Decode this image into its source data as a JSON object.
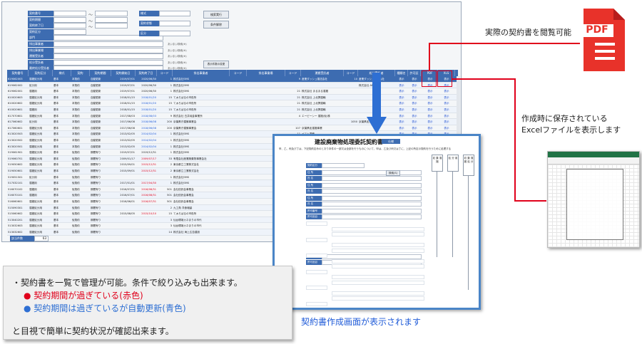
{
  "search": {
    "labels": [
      "契約番号",
      "契約期間",
      "契約終了日",
      "契約区分",
      "部門",
      "排出事業者",
      "排出事業場",
      "運搬受託者",
      "処分受託者",
      "最終処分受託者"
    ],
    "right_labels": [
      "様式",
      "契約状態",
      "区分"
    ],
    "search_button": "検索実行",
    "clear_button": "条件解除",
    "extra_button": "表示件数の変更",
    "hint": "あいまい検索(※)",
    "tilde": "〜"
  },
  "table": {
    "headers": [
      "契約番号",
      "契約区分",
      "様式",
      "契約",
      "契約期間",
      "契約開始日",
      "契約終了日",
      "コード",
      "排出事業者",
      "コード",
      "排出事業場",
      "コード",
      "運搬受託者",
      "コード",
      "処分受託者",
      "種類名",
      "許可証",
      "PDF",
      "XLS"
    ],
    "rows": [
      {
        "no": "619062003",
        "kubun": "運搬処分用",
        "style": "基本",
        "keiyaku": "本契約",
        "kikan": "自動更新",
        "start": "2019/07/01",
        "end": "2020/06/30",
        "code1": "1",
        "haishutsu": "株式会社SMS",
        "code3": "9",
        "unpan": "産業ダッシュ運送会社",
        "code4": "10",
        "shobun": "産業ダッシュ処分会社",
        "link1": "表示",
        "link2": "表示",
        "pdf": "表示",
        "xls": "表示",
        "state": "sel"
      },
      {
        "no": "619062002",
        "kubun": "処分用",
        "style": "基本",
        "keiyaku": "本契約",
        "kikan": "自動更新",
        "start": "2019/07/01",
        "end": "2020/06/30",
        "code1": "1",
        "haishutsu": "株式会社SMS",
        "code3": "",
        "unpan": "",
        "code4": "",
        "shobun": "株式会社 AR",
        "link1": "表示",
        "link2": "表示",
        "pdf": "表示",
        "xls": "表示",
        "state": "alt"
      },
      {
        "no": "619062001",
        "kubun": "運搬用",
        "style": "基本",
        "keiyaku": "本契約",
        "kikan": "自動更新",
        "start": "2019/07/01",
        "end": "2020/06/30",
        "code1": "1",
        "haishutsu": "株式会社SMS",
        "code3": "21",
        "unpan": "株式会社 まるまる運搬",
        "code4": "",
        "shobun": "",
        "link1": "表示",
        "link2": "表示",
        "pdf": "表示",
        "xls": "表示",
        "state": ""
      },
      {
        "no": "610020603",
        "kubun": "運搬処分用",
        "style": "基本",
        "keiyaku": "本契約",
        "kikan": "自動更新",
        "start": "2018/01/15",
        "end": "2018/01/20",
        "end_color": "blue",
        "code1": "15",
        "haishutsu": "てぁろぱるの市役所",
        "code3": "21",
        "unpan": "株式会社 上北興運輸",
        "code4": "",
        "shobun": "",
        "link1": "表示",
        "link2": "表示",
        "pdf": "表示",
        "xls": "表示",
        "state": "alt"
      },
      {
        "no": "610020602",
        "kubun": "運搬処分用",
        "style": "基本",
        "keiyaku": "本契約",
        "kikan": "自動更新",
        "start": "2018/01/15",
        "end": "2018/01/20",
        "end_color": "blue",
        "code1": "15",
        "haishutsu": "てぁろぱるの市役所",
        "code3": "21",
        "unpan": "株式会社 上北興運輸",
        "code4": "",
        "shobun": "",
        "link1": "表示",
        "link2": "表示",
        "pdf": "表示",
        "xls": "表示",
        "state": ""
      },
      {
        "no": "610020601",
        "kubun": "運搬用",
        "style": "基本",
        "keiyaku": "本契約",
        "kikan": "自動更新",
        "start": "2018/01/15",
        "end": "2018/01/20",
        "end_color": "blue",
        "code1": "15",
        "haishutsu": "てぁろぱるの市役所",
        "code3": "21",
        "unpan": "株式会社 上北興運輸",
        "code4": "",
        "shobun": "",
        "link1": "表示",
        "link2": "表示",
        "pdf": "表示",
        "xls": "表示",
        "state": "alt"
      },
      {
        "no": "617070601",
        "kubun": "運搬処分用",
        "style": "基本",
        "keiyaku": "本契約",
        "kikan": "自動更新",
        "start": "2017/08/03",
        "end": "2018/08/03",
        "end_color": "blue",
        "code1": "9",
        "haishutsu": "株式会社 白井純金事業所",
        "code3": "4",
        "unpan": "エーピーシー 運搬(仮)株",
        "code4": "",
        "shobun": "",
        "link1": "表示",
        "link2": "表示",
        "pdf": "表示",
        "xls": "表示",
        "state": ""
      },
      {
        "no": "617060602",
        "kubun": "処分用",
        "style": "基本",
        "keiyaku": "本契約",
        "kikan": "自動更新",
        "start": "2017/06/08",
        "end": "2018/06/08",
        "end_color": "blue",
        "code1": "200",
        "haishutsu": "京葉県庁建築事業会",
        "code3": "",
        "unpan": "",
        "code4": "1050",
        "shobun": "京葉県処分運搬",
        "link1": "表示",
        "link2": "表示",
        "pdf": "表示",
        "xls": "表示",
        "state": "alt"
      },
      {
        "no": "617060601",
        "kubun": "運搬処分用",
        "style": "基本",
        "keiyaku": "本契約",
        "kikan": "自動更新",
        "start": "2017/06/08",
        "end": "2018/06/08",
        "end_color": "blue",
        "code1": "200",
        "haishutsu": "京葉県庁建築事業会",
        "code3": "107",
        "unpan": "京葉県処運搬事業",
        "code4": "",
        "shobun": "",
        "link1": "表示",
        "link2": "表示",
        "pdf": "表示",
        "xls": "表示",
        "state": ""
      },
      {
        "no": "613020503",
        "kubun": "運搬処分用",
        "style": "基本",
        "keiyaku": "本契約",
        "kikan": "自動更新",
        "start": "2013/02/05",
        "end": "2014/02/04",
        "end_color": "blue",
        "code1": "1",
        "haishutsu": "株式会社SMS",
        "code3": "11",
        "unpan": "ペスト運輸",
        "code4": "",
        "shobun": "",
        "link1": "表示",
        "link2": "表示",
        "pdf": "表示",
        "xls": "表示",
        "state": "alt"
      },
      {
        "no": "613020502",
        "kubun": "運搬処分用",
        "style": "基本",
        "keiyaku": "本契約",
        "kikan": "自動更新",
        "start": "2013/02/05",
        "end": "2014/02/04",
        "end_color": "blue",
        "code1": "1",
        "haishutsu": "株式会社SMS",
        "code3": "",
        "unpan": "",
        "code4": "",
        "shobun": "",
        "link1": "表示",
        "link2": "表示",
        "pdf": "表示",
        "xls": "表示",
        "state": ""
      },
      {
        "no": "613020501",
        "kubun": "運搬処分用",
        "style": "基本",
        "keiyaku": "本契約",
        "kikan": "自動更新",
        "start": "2013/02/05",
        "end": "2014/02/04",
        "end_color": "blue",
        "code1": "1",
        "haishutsu": "株式会社SMS",
        "code3": "",
        "unpan": "",
        "code4": "",
        "shobun": "",
        "link1": "表示",
        "link2": "表示",
        "pdf": "表示",
        "xls": "表示",
        "state": "alt"
      },
      {
        "no": "519061901",
        "kubun": "運搬処分用",
        "style": "基本",
        "keiyaku": "仮契約",
        "kikan": "期間有り",
        "start": "2019/07/01",
        "end": "2019/12/31",
        "code1": "1",
        "haishutsu": "株式会社SMS",
        "code3": "12",
        "unpan": "サンプル産業1",
        "code4": "",
        "shobun": "",
        "link1": "表示",
        "link2": "表示",
        "pdf": "表示",
        "xls": "表示",
        "state": ""
      },
      {
        "no": "519060701",
        "kubun": "運搬処分用",
        "style": "基本",
        "keiyaku": "仮契約",
        "kikan": "期間有り",
        "start": "2009/01/17",
        "end": "2009/07/17",
        "end_color": "red",
        "code1": "33",
        "haishutsu": "有限会社産業廃棄物事業会社",
        "code3": "1",
        "unpan": "関 生",
        "code4": "",
        "shobun": "",
        "link1": "表示",
        "link2": "表示",
        "pdf": "表示",
        "xls": "表示",
        "state": "alt"
      },
      {
        "no": "519050602",
        "kubun": "運搬処分用",
        "style": "基本",
        "keiyaku": "仮契約",
        "kikan": "期間有り",
        "start": "2015/09/01",
        "end": "2015/12/31",
        "end_color": "red",
        "code1": "2",
        "haishutsu": "東京都立工業株式会社",
        "code3": "2",
        "unpan": "S2(ペ)ロ河川運搬工",
        "code4": "",
        "shobun": "",
        "link1": "表示",
        "link2": "表示",
        "pdf": "表示",
        "xls": "表示",
        "state": ""
      },
      {
        "no": "519050601",
        "kubun": "運搬処分用",
        "style": "基本",
        "keiyaku": "仮契約",
        "kikan": "期間有り",
        "start": "2015/09/01",
        "end": "2015/12/31",
        "end_color": "red",
        "code1": "2",
        "haishutsu": "東京都立工業株式会社",
        "code3": "2",
        "unpan": "S2(ペ)ロ河川運搬工",
        "code4": "",
        "shobun": "",
        "link1": "表示",
        "link2": "表示",
        "pdf": "表示",
        "xls": "表示",
        "state": "alt"
      },
      {
        "no": "519051501",
        "kubun": "処分用",
        "style": "基本",
        "keiyaku": "仮契約",
        "kikan": "期間有り",
        "start": "",
        "end": "",
        "code1": "1",
        "haishutsu": "株式会社SMS",
        "code3": "",
        "unpan": "",
        "code4": "",
        "shobun": "",
        "link1": "表示",
        "link2": "表示",
        "pdf": "表示",
        "xls": "表示",
        "state": ""
      },
      {
        "no": "517032101",
        "kubun": "運搬用",
        "style": "基本",
        "keiyaku": "仮契約",
        "kikan": "期間有り",
        "start": "2017/01/01",
        "end": "2017/04/30",
        "end_color": "red",
        "code1": "1",
        "haishutsu": "株式会社SMS",
        "code3": "1",
        "unpan": "関 生",
        "code4": "",
        "shobun": "",
        "link1": "表示",
        "link2": "表示",
        "pdf": "表示",
        "xls": "表示",
        "state": "alt"
      },
      {
        "no": "516070102",
        "kubun": "運搬用",
        "style": "基本",
        "keiyaku": "仮契約",
        "kikan": "期間有り",
        "start": "2016/07/01",
        "end": "2016/08/31",
        "end_color": "red",
        "code1": "501",
        "haishutsu": "会社信託会事業会",
        "code3": "1",
        "unpan": "関 生",
        "code4": "",
        "shobun": "",
        "link1": "表示",
        "link2": "表示",
        "pdf": "表示",
        "xls": "表示",
        "state": ""
      },
      {
        "no": "516070101",
        "kubun": "運搬用",
        "style": "基本",
        "keiyaku": "仮契約",
        "kikan": "期間有り",
        "start": "2016/07/01",
        "end": "2016/08/31",
        "end_color": "red",
        "code1": "501",
        "haishutsu": "会社信託会事業会",
        "code3": "1",
        "unpan": "関 生",
        "code4": "",
        "shobun": "",
        "link1": "表示",
        "link2": "表示",
        "pdf": "表示",
        "xls": "表示",
        "state": "alt"
      },
      {
        "no": "516060601",
        "kubun": "運搬処分用",
        "style": "基本",
        "keiyaku": "仮契約",
        "kikan": "期間有り",
        "start": "2016/06/01",
        "end": "2016/07/31",
        "end_color": "red",
        "code1": "501",
        "haishutsu": "会社信託会事業会",
        "code3": "1",
        "unpan": "関 生",
        "code4": "",
        "shobun": "",
        "link1": "表示",
        "link2": "表示",
        "pdf": "表示",
        "xls": "表示",
        "state": ""
      },
      {
        "no": "515090301",
        "kubun": "運搬処分用",
        "style": "基本",
        "keiyaku": "仮契約",
        "kikan": "期間有り",
        "start": "",
        "end": "",
        "code1": "2",
        "haishutsu": "九工角 洋食増髪",
        "code3": "2",
        "unpan": "S2(ペ)ロ河川運搬",
        "code4": "",
        "shobun": "",
        "link1": "表示",
        "link2": "表示",
        "pdf": "表示",
        "xls": "表示",
        "state": "alt"
      },
      {
        "no": "515060602",
        "kubun": "運搬処分用",
        "style": "基本",
        "keiyaku": "仮契約",
        "kikan": "期間有り",
        "start": "2015/08/05",
        "end": "2015/10/10",
        "end_color": "red",
        "code1": "15",
        "haishutsu": "てぁろぱるの市役所",
        "code3": "",
        "unpan": "",
        "code4": "",
        "shobun": "",
        "link1": "表示",
        "link2": "表示",
        "pdf": "表示",
        "xls": "表示",
        "state": ""
      },
      {
        "no": "513040201",
        "kubun": "運搬処分用",
        "style": "基本",
        "keiyaku": "仮契約",
        "kikan": "期間有り",
        "start": "",
        "end": "",
        "code1": "3",
        "haishutsu": "仙台環境カネまりの市代",
        "code3": "2",
        "unpan": "まるまる所域",
        "code4": "",
        "shobun": "",
        "link1": "表示",
        "link2": "表示",
        "pdf": "表示",
        "xls": "表示",
        "state": "alt"
      },
      {
        "no": "513032603",
        "kubun": "運搬処分用",
        "style": "基本",
        "keiyaku": "仮契約",
        "kikan": "期間有り",
        "start": "",
        "end": "",
        "code1": "3",
        "haishutsu": "仙台環境カネまりの市代",
        "code3": "",
        "unpan": "",
        "code4": "",
        "shobun": "",
        "link1": "表示",
        "link2": "表示",
        "pdf": "表示",
        "xls": "表示",
        "state": ""
      },
      {
        "no": "513032602",
        "kubun": "運搬処分用",
        "style": "基本",
        "keiyaku": "仮契約",
        "kikan": "期間有り",
        "start": "",
        "end": "",
        "code1": "14",
        "haishutsu": "株式会社 海上広告建設",
        "code3": "",
        "unpan": "",
        "code4": "",
        "shobun": "",
        "link1": "表示",
        "link2": "表示",
        "pdf": "表示",
        "xls": "表示",
        "state": "alt"
      }
    ],
    "count_label": "該当件数",
    "count_value": "63"
  },
  "annotations": {
    "pdf_caption": "実際の契約書を閲覧可能",
    "pdf_icon_text": "PDF",
    "excel_caption_1": "作成時に保存されている",
    "excel_caption_2": "Excelファイルを表示します",
    "form_caption": "契約書作成画面が表示されます"
  },
  "note": {
    "line1": "・契約書を一覧で管理が可能。条件で絞り込みも出来ます。",
    "line2": "● 契約期間が過ぎている(赤色)",
    "line3": "● 契約期間は過ぎているが自動更新(青色)",
    "line4": "と目視で簡単に契約状況が確認出来ます。"
  },
  "form": {
    "title": "建設廃棄物処理委託契約書",
    "badge": "仕様",
    "intro": "甲、乙、丙及び丁は、下記契約定めのとおり本件の一部又は全部を行うものについて、甲は、乙及び丙又は丁に、上記の所定の契約を行うために処理する",
    "field_labels": [
      "契約区分",
      "住 所",
      "氏 名",
      "住 所",
      "氏 名",
      "住 所",
      "氏 名",
      "許可番号",
      "許可品目",
      "許可番号",
      "許可品目"
    ],
    "side_labels": [
      "収 集 運 搬",
      "処 分 用",
      "収 集 運 搬 処 分"
    ],
    "button": "検索(S)"
  },
  "colors": {
    "header_blue": "#3d6cb1",
    "red": "#e0001b",
    "blue": "#1f5bd8",
    "pdf_red": "#e8322a",
    "arrow_blue": "#2e6fd3",
    "excel_green": "#217346"
  }
}
